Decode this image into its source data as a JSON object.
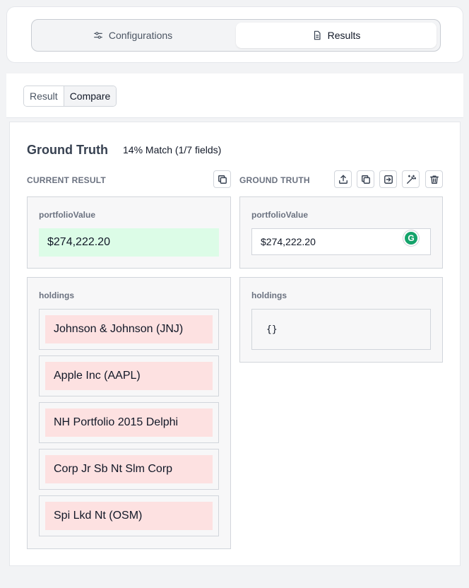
{
  "tabs": {
    "configurations": {
      "label": "Configurations",
      "icon": "sliders-icon"
    },
    "results": {
      "label": "Results",
      "icon": "document-icon"
    }
  },
  "view_toggle": {
    "result": "Result",
    "compare": "Compare",
    "selected": "Compare"
  },
  "panel": {
    "title": "Ground Truth",
    "match": "14% Match (1/7 fields)"
  },
  "current": {
    "label": "CURRENT RESULT",
    "portfolio_label": "portfolioValue",
    "portfolio_value": "$274,222.20",
    "holdings_label": "holdings",
    "holdings": [
      "Johnson & Johnson (JNJ)",
      "Apple Inc (AAPL)",
      "NH Portfolio 2015 Delphi",
      "Corp Jr Sb Nt Slm Corp",
      "Spi Lkd Nt (OSM)"
    ]
  },
  "ground_truth": {
    "label": "GROUND TRUTH",
    "portfolio_label": "portfolioValue",
    "portfolio_value": "$274,222.20",
    "holdings_label": "holdings",
    "holdings_value": "{}"
  },
  "colors": {
    "match": "#dcfce7",
    "mismatch": "#fde1e1",
    "grammarly": "#15a36b"
  }
}
